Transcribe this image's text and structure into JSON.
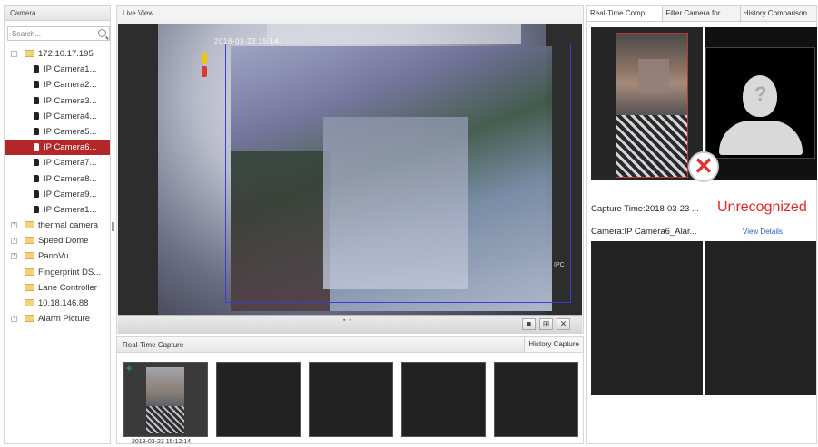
{
  "camera_panel": {
    "title": "Camera",
    "search_placeholder": "Search...",
    "tree": [
      {
        "label": "172.10.17.195",
        "type": "folder",
        "expander": "-"
      },
      {
        "label": "IP Camera1...",
        "type": "camera"
      },
      {
        "label": "IP Camera2...",
        "type": "camera"
      },
      {
        "label": "IP Camera3...",
        "type": "camera"
      },
      {
        "label": "IP Camera4...",
        "type": "camera"
      },
      {
        "label": "IP Camera5...",
        "type": "camera"
      },
      {
        "label": "IP Camera6...",
        "type": "camera",
        "selected": true
      },
      {
        "label": "IP Camera7...",
        "type": "camera"
      },
      {
        "label": "IP Camera8...",
        "type": "camera"
      },
      {
        "label": "IP Camera9...",
        "type": "camera"
      },
      {
        "label": "IP Camera1...",
        "type": "camera"
      },
      {
        "label": "thermal camera",
        "type": "folder",
        "expander": "+"
      },
      {
        "label": "Speed Dome",
        "type": "folder",
        "expander": "+"
      },
      {
        "label": "PanoVu",
        "type": "folder",
        "expander": "+"
      },
      {
        "label": "Fingerprint DS...",
        "type": "folder"
      },
      {
        "label": "Lane Controller",
        "type": "folder"
      },
      {
        "label": "10.18.146.88",
        "type": "folder"
      },
      {
        "label": "Alarm Picture",
        "type": "folder",
        "expander": "+"
      }
    ]
  },
  "live_view": {
    "title": "Live View",
    "osd_date": "2018-03-23  15:14:",
    "osd_camera": "IPC",
    "controls": [
      {
        "name": "stop-button",
        "glyph": "■"
      },
      {
        "name": "layout-button",
        "glyph": "⊞"
      },
      {
        "name": "close-button",
        "glyph": "✕"
      }
    ],
    "grip": "▪ ▪"
  },
  "capture": {
    "title": "Real-Time Capture",
    "history_button": "History Capture",
    "plus": "+",
    "thumb_time": "2018-03-23 15:12:14"
  },
  "comparison": {
    "tabs": [
      "Real-Time Comp...",
      "Filter Camera for ...",
      "History Comparison"
    ],
    "placeholder_glyph": "?",
    "mismatch_glyph": "✕",
    "capture_time_label": "Capture Time:2018-03-23 ...",
    "status": "Unrecognized",
    "camera_label": "Camera:IP Camera6_Alar...",
    "view_details": "View Details"
  },
  "colors": {
    "selection": "#b3262a",
    "status_red": "#e0262b",
    "link_blue": "#2b5fc4",
    "roi_blue": "#3a3dd6"
  }
}
